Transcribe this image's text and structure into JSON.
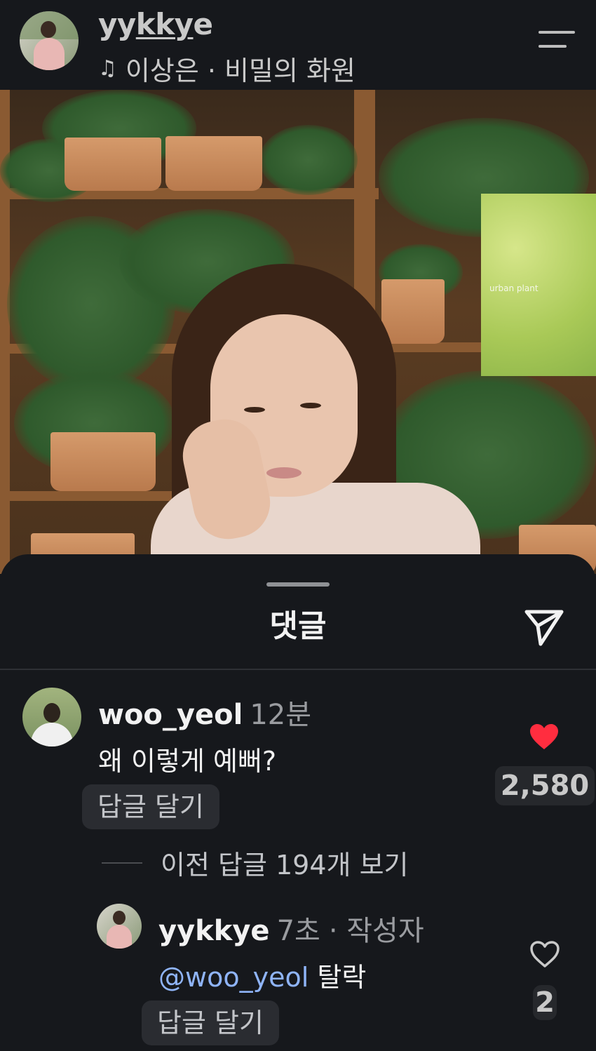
{
  "header": {
    "username_prefix": "yy",
    "username_underlined": "kky",
    "username_suffix": "e",
    "music_icon": "music-note-icon",
    "song": "이상은 · 비밀의 화원",
    "menu_icon": "menu-icon"
  },
  "photo": {
    "poster_text": "urban plant"
  },
  "sheet": {
    "title": "댓글",
    "send_icon": "send-icon"
  },
  "comments": [
    {
      "username": "woo_yeol",
      "time": "12분",
      "text": "왜 이렇게 예뻐?",
      "reply_label": "답글 달기",
      "like_icon": "heart-filled-icon",
      "like_color": "#ff2d3f",
      "like_count": "2,580"
    }
  ],
  "view_previous": "이전 답글 194개 보기",
  "replies": [
    {
      "username": "yykkye",
      "time": "7초",
      "author_badge": "· 작성자",
      "mention": "@woo_yeol",
      "text": "탈락",
      "reply_label": "답글 달기",
      "like_icon": "heart-outline-icon",
      "like_count": "2"
    }
  ]
}
